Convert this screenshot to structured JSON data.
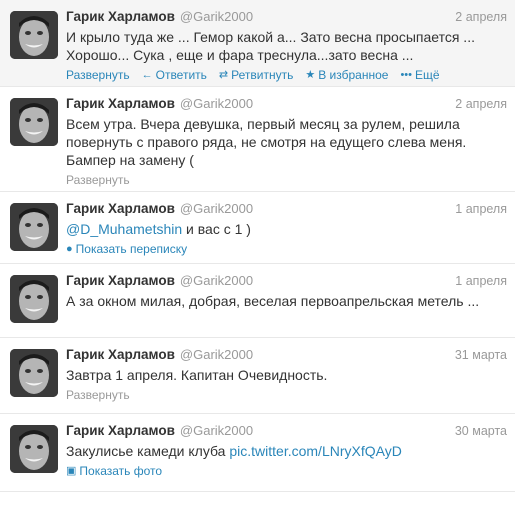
{
  "author": {
    "name": "Гарик Харламов",
    "handle": "@Garik2000"
  },
  "tweets": [
    {
      "time": "2 апреля",
      "lines": [
        "И крыло туда же ... Гемор какой а... Зато весна просыпается ...",
        "Хорошо... Сука , еще и фара треснула...зато весна ..."
      ],
      "actions": {
        "expand": "Развернуть",
        "reply": "Ответить",
        "retweet": "Ретвитнуть",
        "favorite": "В избранное",
        "more": "Ещё"
      }
    },
    {
      "time": "2 апреля",
      "lines": [
        "Всем утра. Вчера девушка, первый месяц за рулем, решила",
        "повернуть с правого ряда, не смотря на едущего слева меня.",
        "Бампер на замену ("
      ],
      "expand": "Развернуть"
    },
    {
      "time": "1 апреля",
      "mention": "@D_Muhametshin",
      "rest": " и вас с 1 )",
      "conversation": "Показать переписку"
    },
    {
      "time": "1 апреля",
      "lines": [
        "А за окном милая, добрая, веселая первоапрельская метель ..."
      ]
    },
    {
      "time": "31 марта",
      "lines": [
        "Завтра 1 апреля. Капитан Очевидность."
      ],
      "expand": "Развернуть"
    },
    {
      "time": "30 марта",
      "text_before": "Закулисье камеди клуба ",
      "link": "pic.twitter.com/LNryXfQAyD",
      "photo": "Показать фото"
    }
  ],
  "icons": {
    "reply": "reply-icon",
    "retweet": "retweet-icon",
    "favorite": "star-icon",
    "more": "more-icon",
    "conversation": "speech-bubble-icon",
    "photo": "photo-icon"
  },
  "colors": {
    "link": "#2a86b9",
    "meta": "#999999",
    "text": "#333333",
    "hover_bg": "#f5f5f5"
  }
}
